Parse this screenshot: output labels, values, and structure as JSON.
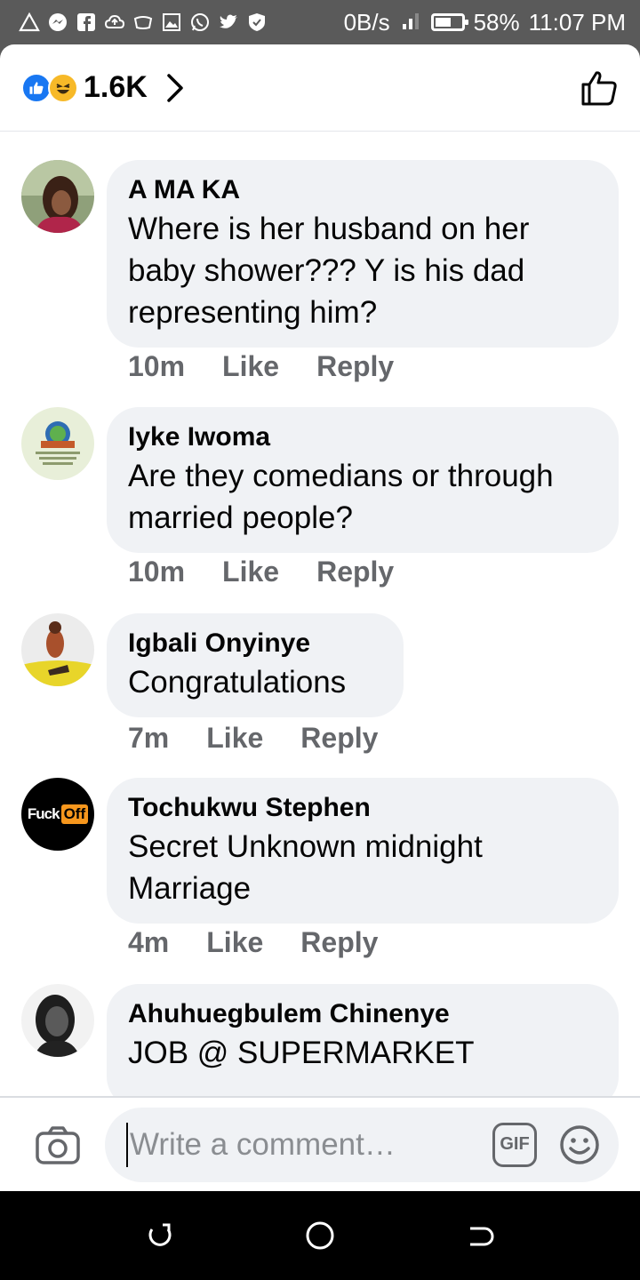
{
  "status_bar": {
    "icons": [
      "alert-icon",
      "messenger-icon",
      "facebook-icon",
      "cloud-icon",
      "tv-icon",
      "gallery-icon",
      "whatsapp-icon",
      "twitter-icon",
      "shield-icon"
    ],
    "speed": "0B/s",
    "battery": "58%",
    "time": "11:07 PM"
  },
  "header": {
    "reaction_count": "1.6K"
  },
  "comments": [
    {
      "author": "A MA KA",
      "text": "Where is her husband on her baby shower??? Y is his dad representing him?",
      "time": "10m",
      "like": "Like",
      "reply": "Reply"
    },
    {
      "author": "Iyke Iwoma",
      "text": "Are they comedians or through married people?",
      "time": "10m",
      "like": "Like",
      "reply": "Reply"
    },
    {
      "author": "Igbali Onyinye",
      "text": "Congratulations",
      "time": "7m",
      "like": "Like",
      "reply": "Reply"
    },
    {
      "author": "Tochukwu Stephen",
      "text": "Secret Unknown midnight Marriage",
      "time": "4m",
      "like": "Like",
      "reply": "Reply"
    },
    {
      "author": "Ahuhuegbulem Chinenye",
      "text": "JOB @ SUPERMARKET",
      "time": "",
      "like": "",
      "reply": ""
    }
  ],
  "avatars": {
    "tochukwu_badge_left": "Fuck",
    "tochukwu_badge_right": "Off"
  },
  "composer": {
    "placeholder": "Write a comment…",
    "gif_label": "GIF"
  },
  "colors": {
    "accent": "#1877f2",
    "bubble": "#f0f2f5",
    "secondary_text": "#65676b"
  }
}
